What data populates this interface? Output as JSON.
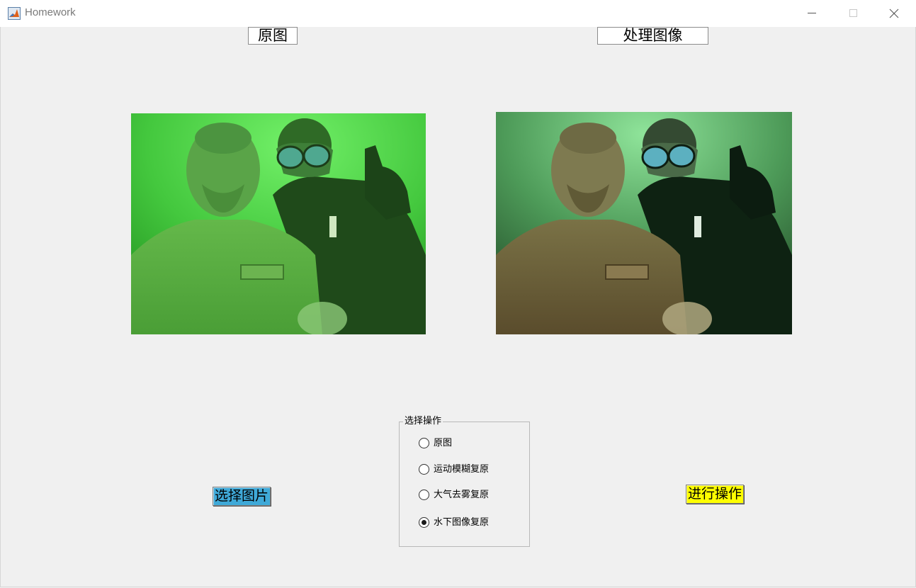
{
  "window": {
    "title": "Homework",
    "app_icon": "matlab-icon",
    "controls": [
      "minimize-icon",
      "maximize-icon",
      "close-icon"
    ]
  },
  "labels": {
    "original": "原图",
    "processed": "处理图像"
  },
  "images": {
    "original": {
      "subject": "underwater statue and diver",
      "tint": "#4fd04f"
    },
    "processed": {
      "subject": "underwater statue and diver",
      "tint": "#6a9a60"
    }
  },
  "buttons": {
    "select_image": {
      "label": "选择图片",
      "color": "#3fa9d8"
    },
    "run": {
      "label": "进行操作",
      "color": "#ffff00"
    }
  },
  "operation_group": {
    "title": "选择操作",
    "options": [
      {
        "label": "原图",
        "selected": false
      },
      {
        "label": "运动模糊复原",
        "selected": false
      },
      {
        "label": "大气去雾复原",
        "selected": false
      },
      {
        "label": "水下图像复原",
        "selected": true
      }
    ]
  }
}
